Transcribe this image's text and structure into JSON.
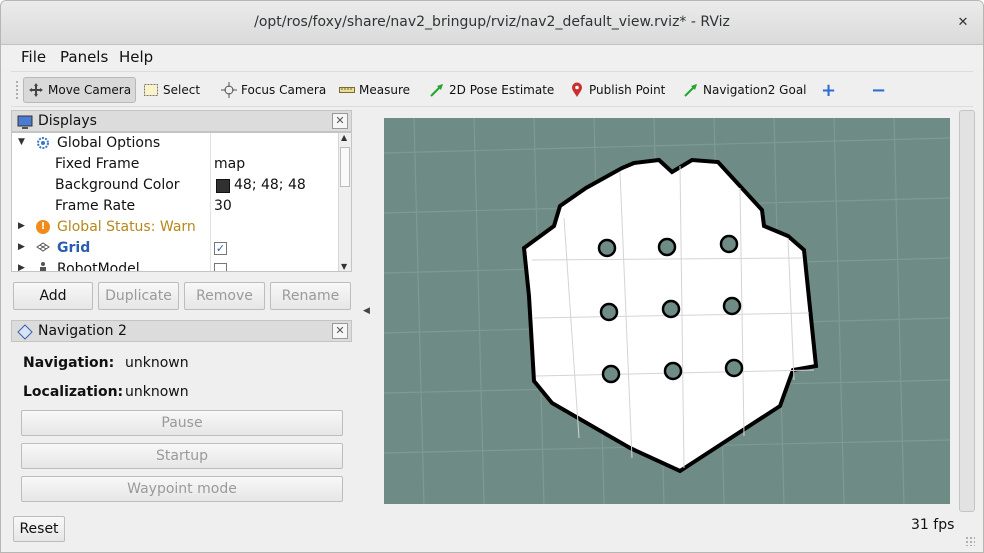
{
  "window": {
    "title": "/opt/ros/foxy/share/nav2_bringup/rviz/nav2_default_view.rviz* - RViz",
    "close_label": "✕"
  },
  "menu": {
    "file": "File",
    "panels": "Panels",
    "help": "Help"
  },
  "toolbar": {
    "move_camera": "Move Camera",
    "select": "Select",
    "focus_camera": "Focus Camera",
    "measure": "Measure",
    "pose_estimate": "2D Pose Estimate",
    "publish_point": "Publish Point",
    "nav_goal": "Navigation2 Goal",
    "add_tool": "+",
    "remove_tool": "−"
  },
  "displays": {
    "title": "Displays",
    "rows": [
      {
        "name": "Global Options",
        "value": ""
      },
      {
        "name": "Fixed Frame",
        "value": "map"
      },
      {
        "name": "Background Color",
        "value": "48; 48; 48"
      },
      {
        "name": "Frame Rate",
        "value": "30"
      },
      {
        "name": "Global Status: Warn",
        "value": ""
      },
      {
        "name": "Grid",
        "value": "✓"
      },
      {
        "name": "RobotModel",
        "value": ""
      }
    ],
    "buttons": {
      "add": "Add",
      "duplicate": "Duplicate",
      "remove": "Remove",
      "rename": "Rename"
    },
    "colors": {
      "warn": "#b5891a",
      "grid_label": "#2a5db0",
      "background_swatch": "#303030"
    }
  },
  "navigation": {
    "title": "Navigation 2",
    "navigation_label": "Navigation:",
    "navigation_value": "unknown",
    "localization_label": "Localization:",
    "localization_value": "unknown",
    "pause": "Pause",
    "startup": "Startup",
    "waypoint": "Waypoint mode"
  },
  "footer": {
    "reset": "Reset",
    "fps": "31 fps"
  },
  "view": {
    "background": "#6f8b86",
    "map_fill": "#ffffff",
    "obstacle_color": "#000000"
  }
}
